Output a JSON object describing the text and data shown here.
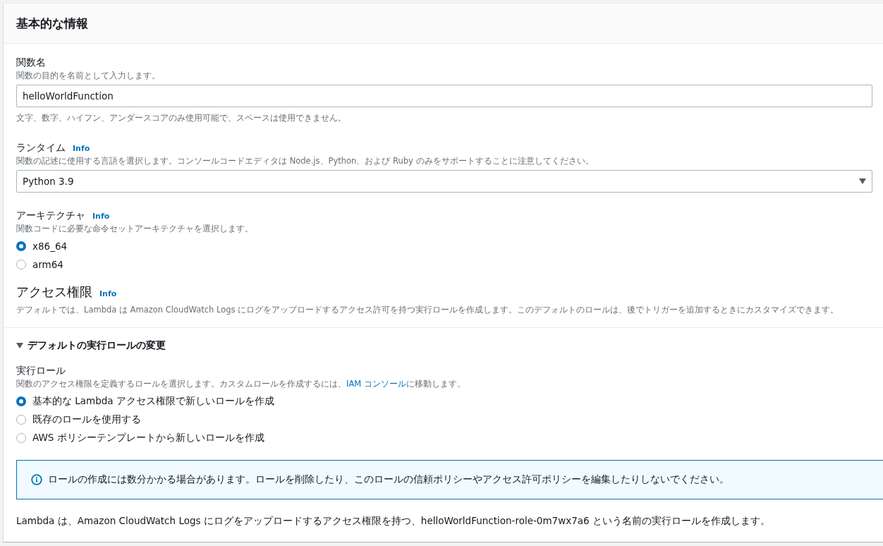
{
  "panel": {
    "title": "基本的な情報"
  },
  "function_name": {
    "label": "関数名",
    "description": "関数の目的を名前として入力します。",
    "value": "helloWorldFunction",
    "hint": "文字、数字、ハイフン、アンダースコアのみ使用可能で、スペースは使用できません。"
  },
  "runtime": {
    "label": "ランタイム",
    "info": "Info",
    "description": "関数の記述に使用する言語を選択します。コンソールコードエディタは Node.js、Python、および Ruby のみをサポートすることに注意してください。",
    "value": "Python 3.9"
  },
  "architecture": {
    "label": "アーキテクチャ",
    "info": "Info",
    "description": "関数コードに必要な命令セットアーキテクチャを選択します。",
    "options": [
      {
        "label": "x86_64",
        "selected": true
      },
      {
        "label": "arm64",
        "selected": false
      }
    ]
  },
  "permissions": {
    "title": "アクセス権限",
    "info": "Info",
    "description": "デフォルトでは、Lambda は Amazon CloudWatch Logs にログをアップロードするアクセス許可を持つ実行ロールを作成します。このデフォルトのロールは、後でトリガーを追加するときにカスタマイズできます。"
  },
  "expander": {
    "label": "デフォルトの実行ロールの変更",
    "expanded": true
  },
  "execution_role": {
    "label": "実行ロール",
    "description_before": "関数のアクセス権限を定義するロールを選択します。カスタムロールを作成するには、",
    "link": "IAM コンソール",
    "description_after": "に移動します。",
    "options": [
      {
        "label": "基本的な Lambda アクセス権限で新しいロールを作成",
        "selected": true
      },
      {
        "label": "既存のロールを使用する",
        "selected": false
      },
      {
        "label": "AWS ポリシーテンプレートから新しいロールを作成",
        "selected": false
      }
    ]
  },
  "info_alert": {
    "text": "ロールの作成には数分かかる場合があります。ロールを削除したり、このロールの信頼ポリシーやアクセス許可ポリシーを編集したりしないでください。"
  },
  "footer_note": "Lambda は、Amazon CloudWatch Logs にログをアップロードするアクセス権限を持つ、helloWorldFunction-role-0m7wx7a6 という名前の実行ロールを作成します。"
}
